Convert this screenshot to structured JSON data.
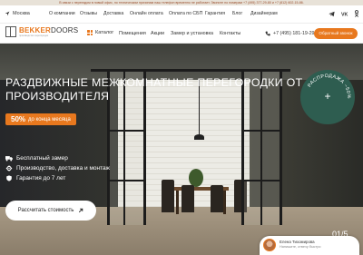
{
  "announcement": "В связи с переездом в новый офис, по техническим причинам наш телефон временно не работает. Звоните по номерам +7 (495) 377-29-80 и +7 (812) 602-15-86.",
  "city": "Москва",
  "top_links": [
    "О компании",
    "Отзывы",
    "Доставка",
    "Онлайн оплата",
    "Оплата по СБП",
    "Гарантия",
    "Блог",
    "Дизайнерам"
  ],
  "socials": [
    "telegram-icon",
    "vk-icon",
    "odnoklassniki-icon"
  ],
  "logo": {
    "brand_a": "BEKKER",
    "brand_b": "DOORS",
    "tagline": "производство перегородок"
  },
  "header": {
    "catalog_label": "Каталог",
    "menu": [
      "Помещения",
      "Акции",
      "Замер и установка",
      "Контакты"
    ],
    "phone": "+7 (495) 181-19-29",
    "call_button": "Обратный звонок"
  },
  "hero": {
    "title": "Раздвижные межкомнатные перегородки от производителя",
    "promo_big": "50%",
    "promo_small": "до конца месяца",
    "features": [
      "Бесплатный замер",
      "Производство, доставка и монтаж",
      "Гарантия до 7 лет"
    ],
    "cta": "Рассчитать стоимость",
    "badge_text": "РАСПРОДАЖА −50%",
    "slide_counter": "01/5"
  },
  "chat": {
    "name": "Елена Тихомирова",
    "subtitle": "Напишите, отвечу быстро"
  },
  "colors": {
    "accent": "#e8781e",
    "badge": "#2e5d50"
  }
}
